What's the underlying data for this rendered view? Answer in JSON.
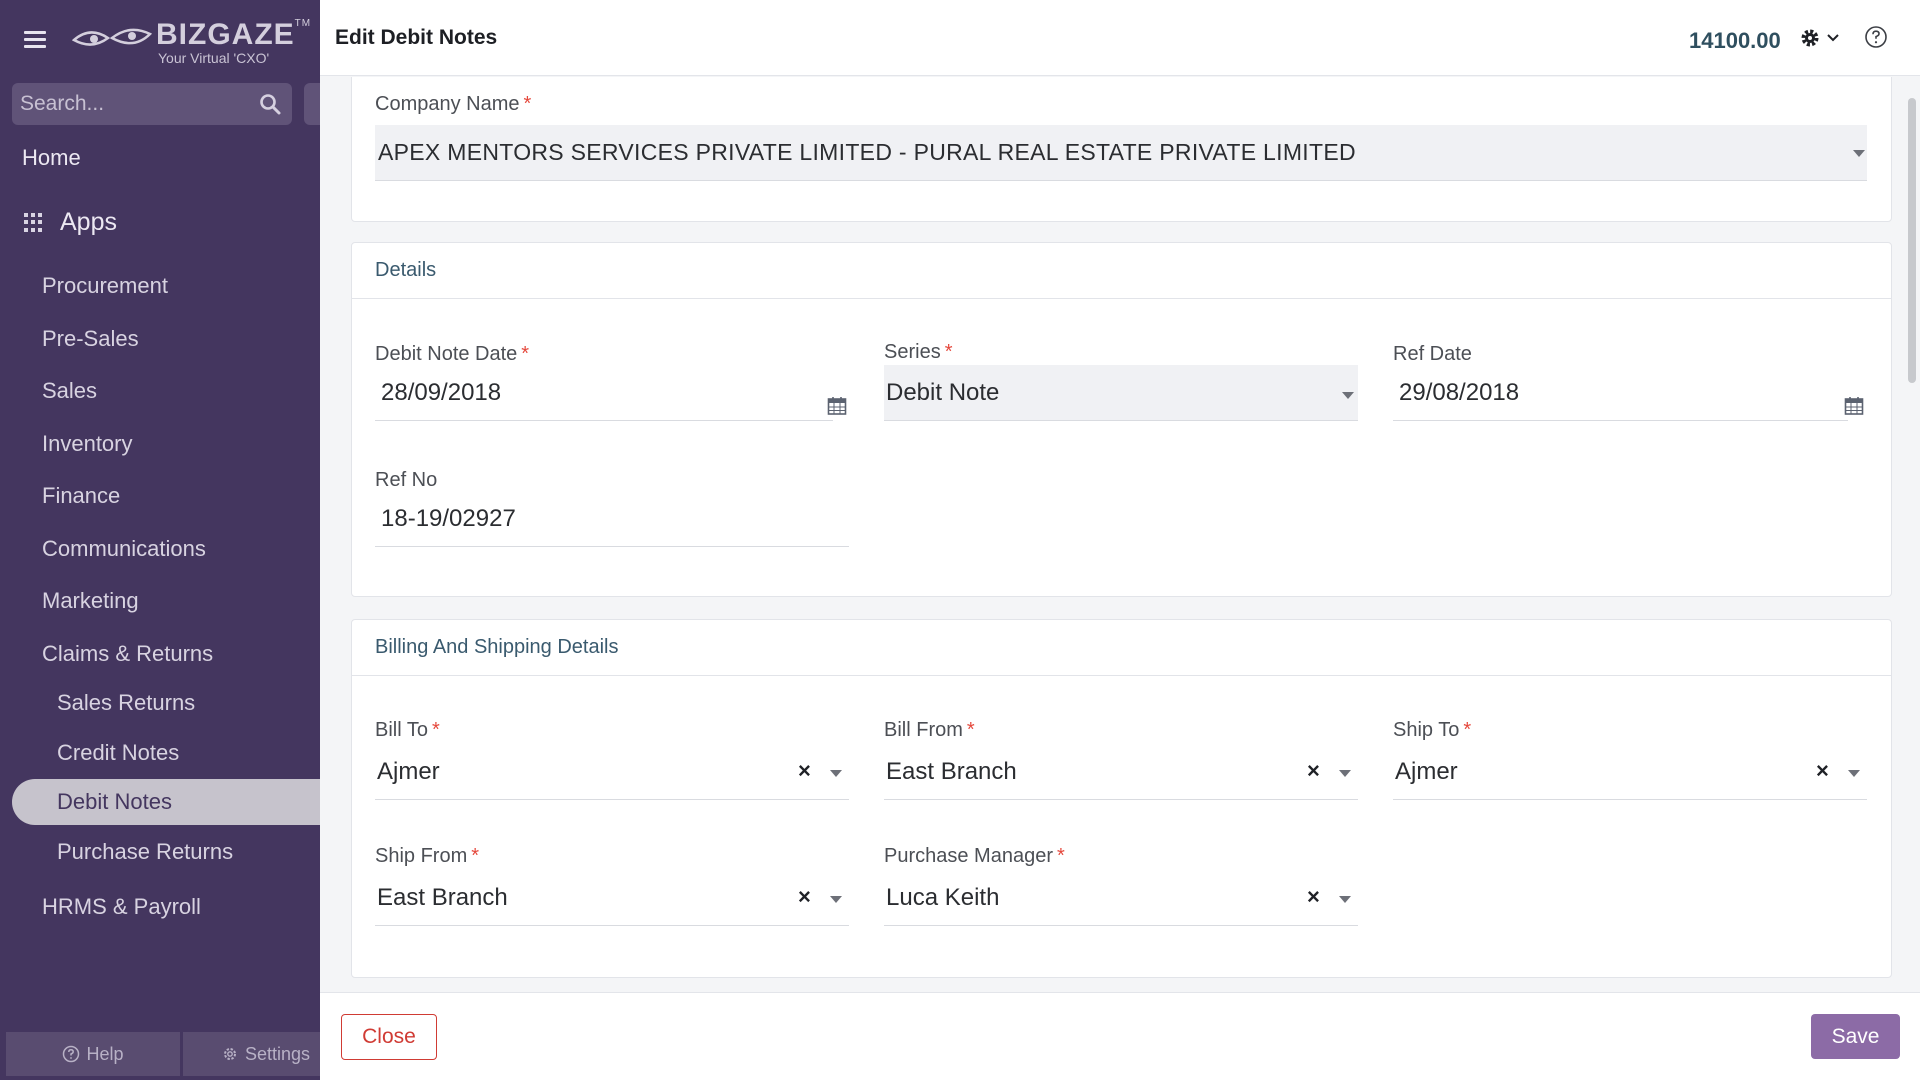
{
  "sidebar": {
    "logo": {
      "brand": "BIZGAZE",
      "tm": "TM",
      "tagline": "Your Virtual 'CXO'"
    },
    "search": {
      "placeholder": "Search..."
    },
    "home_label": "Home",
    "apps_label": "Apps",
    "items": [
      "Procurement",
      "Pre-Sales",
      "Sales",
      "Inventory",
      "Finance",
      "Communications",
      "Marketing",
      "Claims & Returns"
    ],
    "sub_items": [
      "Sales Returns",
      "Credit Notes",
      "Debit Notes",
      "Purchase Returns"
    ],
    "active_item": "Debit Notes",
    "last_item": "HRMS & Payroll",
    "footer": {
      "help": "Help",
      "settings": "Settings"
    }
  },
  "header": {
    "title": "Edit Debit Notes",
    "amount": "14100.00"
  },
  "company": {
    "label": "Company Name",
    "value": "APEX MENTORS SERVICES PRIVATE LIMITED - PURAL REAL ESTATE PRIVATE LIMITED"
  },
  "details": {
    "heading": "Details",
    "debit_note_date": {
      "label": "Debit Note Date",
      "value": "28/09/2018"
    },
    "series": {
      "label": "Series",
      "value": "Debit Note"
    },
    "ref_date": {
      "label": "Ref Date",
      "value": "29/08/2018"
    },
    "ref_no": {
      "label": "Ref No",
      "value": "18-19/02927"
    }
  },
  "billing": {
    "heading": "Billing And Shipping Details",
    "bill_to": {
      "label": "Bill To",
      "value": "Ajmer"
    },
    "bill_from": {
      "label": "Bill From",
      "value": "East Branch"
    },
    "ship_to": {
      "label": "Ship To",
      "value": "Ajmer"
    },
    "ship_from": {
      "label": "Ship From",
      "value": "East Branch"
    },
    "purchase_manager": {
      "label": "Purchase Manager",
      "value": "Luca Keith"
    }
  },
  "required_marker": "*",
  "clear_glyph": "×",
  "actions": {
    "close": "Close",
    "save": "Save"
  },
  "colors": {
    "sidebar": "#44365f",
    "accent": "#8c6ba6",
    "danger": "#d03b34",
    "required": "#e5483c"
  }
}
